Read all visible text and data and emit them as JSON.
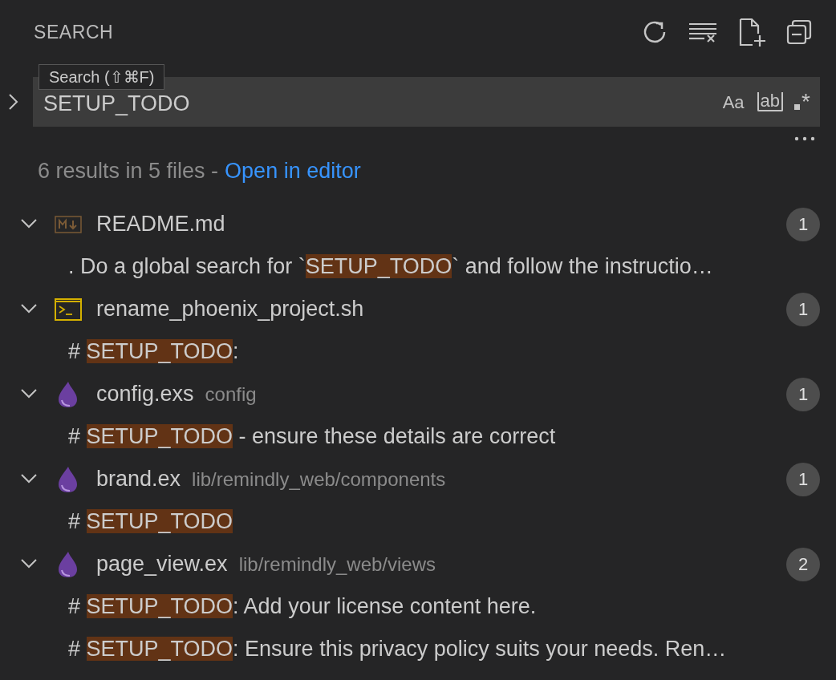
{
  "header": {
    "title": "SEARCH"
  },
  "tooltip": "Search (⇧⌘F)",
  "search": {
    "value": "SETUP_TODO",
    "options": [
      "Aa",
      "ab",
      "*"
    ],
    "expanded": false
  },
  "summary": {
    "text": "6 results in 5 files -",
    "link": "Open in editor"
  },
  "files": [
    {
      "name": "README.md",
      "kind": "markdown",
      "expanded": true,
      "count": "1",
      "matches": [
        {
          "before": ". Do a global search for `",
          "match": "SETUP_TODO",
          "after": "` and follow the instructio…"
        }
      ]
    },
    {
      "name": "rename_phoenix_project.sh",
      "kind": "shell",
      "expanded": true,
      "count": "1",
      "matches": [
        {
          "before": "# ",
          "match": "SETUP_TODO",
          "after": ":"
        }
      ]
    },
    {
      "name": "config.exs",
      "path": "config",
      "kind": "elixir",
      "expanded": true,
      "count": "1",
      "matches": [
        {
          "before": "# ",
          "match": "SETUP_TODO",
          "after": " - ensure these details are correct"
        }
      ]
    },
    {
      "name": "brand.ex",
      "path": "lib/remindly_web/components",
      "kind": "elixir",
      "expanded": true,
      "count": "1",
      "matches": [
        {
          "before": "# ",
          "match": "SETUP_TODO"
        }
      ]
    },
    {
      "name": "page_view.ex",
      "path": "lib/remindly_web/views",
      "kind": "elixir",
      "expanded": true,
      "count": "2",
      "matches": [
        {
          "before": "# ",
          "match": "SETUP_TODO",
          "after": ": Add your license content here."
        },
        {
          "before": "# ",
          "match": "SETUP_TODO",
          "after": ": Ensure this privacy policy suits your needs. Ren…"
        }
      ]
    }
  ]
}
